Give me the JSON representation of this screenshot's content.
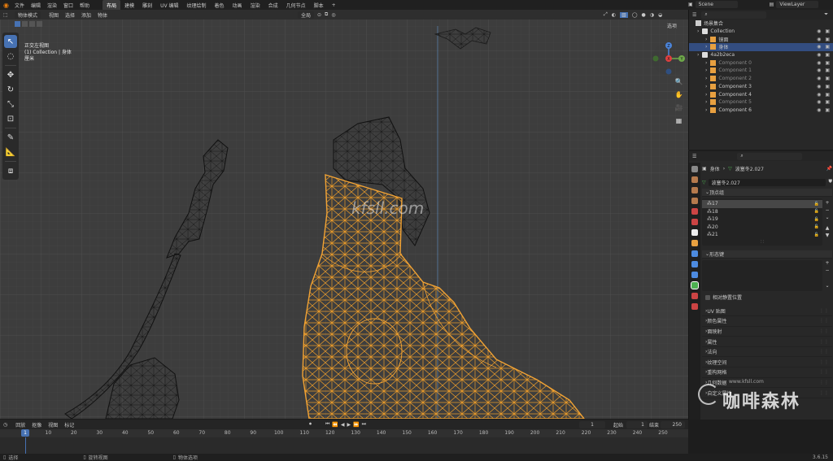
{
  "topbar": {
    "menus": [
      "文件",
      "编辑",
      "渲染",
      "窗口",
      "帮助"
    ],
    "tabs": [
      "布局",
      "建模",
      "雕刻",
      "UV 编辑",
      "纹理绘制",
      "着色",
      "动画",
      "渲染",
      "合成",
      "几何节点",
      "脚本"
    ],
    "active_tab": "布局",
    "scene_label": "Scene",
    "viewlayer_label": "ViewLayer"
  },
  "viewport": {
    "mode_label": "物体模式",
    "menus": [
      "视图",
      "选择",
      "添加",
      "物体"
    ],
    "transform_label": "全局",
    "options_label": "选项",
    "view_name": "正交左视图",
    "collection_info": "(1) Collection | 身体",
    "unit_label": "厘米",
    "watermark_center": "kfsll.com",
    "gizmo_axes": {
      "x": "X",
      "y": "Y",
      "z": "Z"
    }
  },
  "outliner": {
    "root": "场景集合",
    "rows": [
      {
        "label": "Collection",
        "type": "collection",
        "indent": 0,
        "selected": false
      },
      {
        "label": "镜面",
        "type": "mesh",
        "indent": 1,
        "selected": false
      },
      {
        "label": "身体",
        "type": "mesh",
        "indent": 1,
        "selected": true
      },
      {
        "label": "4a2b2eca",
        "type": "collection",
        "indent": 0,
        "selected": false
      },
      {
        "label": "Component 0",
        "type": "mesh",
        "indent": 1,
        "selected": false
      },
      {
        "label": "Component 1",
        "type": "mesh",
        "indent": 1,
        "selected": false
      },
      {
        "label": "Component 2",
        "type": "mesh",
        "indent": 1,
        "selected": false
      },
      {
        "label": "Component 3",
        "type": "mesh",
        "indent": 1,
        "selected": false
      },
      {
        "label": "Component 4",
        "type": "mesh",
        "indent": 1,
        "selected": false
      },
      {
        "label": "Component 5",
        "type": "mesh",
        "indent": 1,
        "selected": false
      },
      {
        "label": "Component 6",
        "type": "mesh",
        "indent": 1,
        "selected": false
      }
    ]
  },
  "properties": {
    "breadcrumb_object": "身体",
    "breadcrumb_mesh": "波塞冬2.027",
    "mesh_name": "波塞冬2.027",
    "vertex_groups_title": "顶点组",
    "vertex_groups": [
      "17",
      "18",
      "19",
      "20",
      "21"
    ],
    "shape_keys_title": "形态键",
    "shape_keys_option": "相对静置位置",
    "collapsed_panels": [
      "UV 贴图",
      "颜色属性",
      "面映射",
      "属性",
      "法向",
      "纹理空间",
      "重构网格",
      "几何数据",
      "自定义属性"
    ]
  },
  "timeline": {
    "menus": [
      "回放",
      "抠像",
      "视图",
      "标记"
    ],
    "current_frame": "1",
    "start_label": "起始",
    "start_value": "1",
    "end_label": "结束",
    "end_value": "250",
    "ruler_marks": [
      "10",
      "20",
      "30",
      "40",
      "50",
      "60",
      "70",
      "80",
      "90",
      "100",
      "110",
      "120",
      "130",
      "140",
      "150",
      "160",
      "170",
      "180",
      "190",
      "200",
      "210",
      "220",
      "230",
      "240",
      "250"
    ],
    "playhead_label": "1"
  },
  "statusbar": {
    "left": "选择",
    "middle": "旋转视图",
    "right": "物体选项",
    "version": "3.6.15"
  },
  "watermark": {
    "url": "www.kfsll.com",
    "text": "咖啡森林"
  },
  "colors": {
    "accent": "#4772b3",
    "selection_orange": "#f0a030",
    "wire": "#111111",
    "viewport_bg": "#3d3d3d"
  }
}
